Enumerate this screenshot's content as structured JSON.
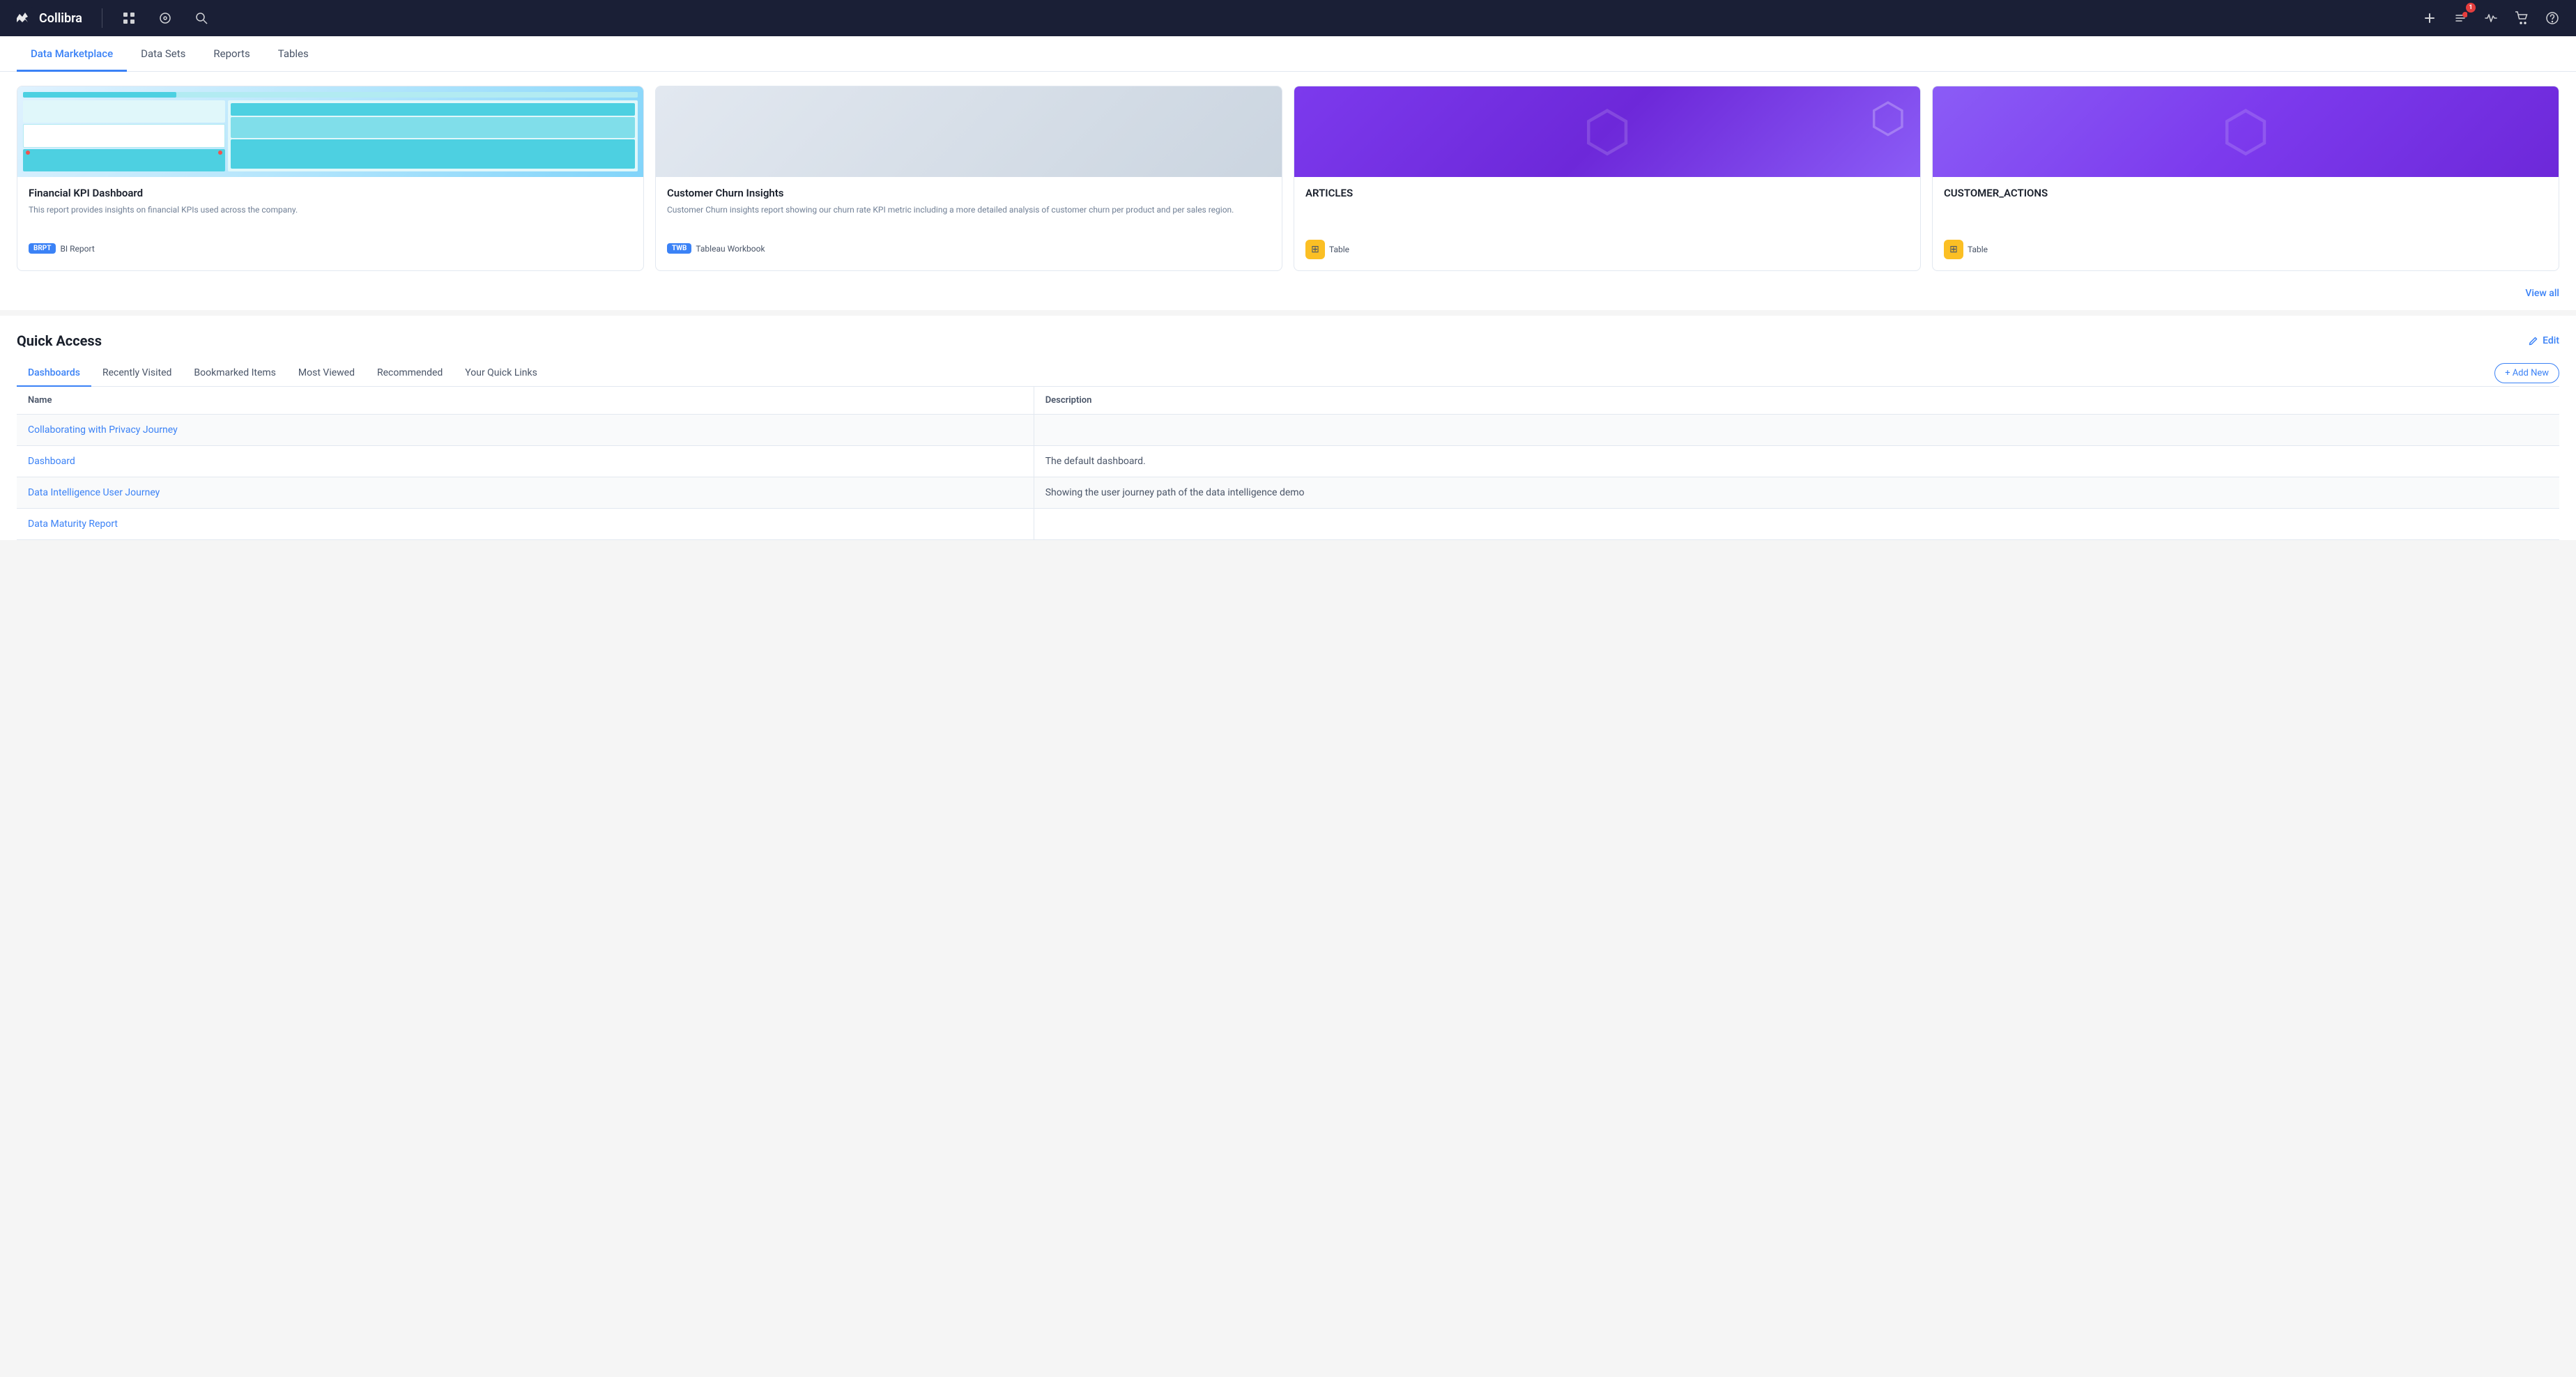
{
  "topnav": {
    "logo_text": "Collibra",
    "icons": [
      "grid",
      "compass",
      "search"
    ],
    "right_icons": [
      "plus",
      "tasks",
      "activity",
      "cart",
      "help"
    ],
    "badge_count": "1"
  },
  "tabs": {
    "items": [
      {
        "label": "Data Marketplace",
        "active": true
      },
      {
        "label": "Data Sets",
        "active": false
      },
      {
        "label": "Reports",
        "active": false
      },
      {
        "label": "Tables",
        "active": false
      }
    ]
  },
  "cards": [
    {
      "title": "Financial KPI Dashboard",
      "description": "This report provides insights on financial KPIs used across the company.",
      "badge_code": "BRPT",
      "badge_label": "BI Report",
      "type": "dashboard"
    },
    {
      "title": "Customer Churn Insights",
      "description": "Customer Churn insights report showing our churn rate KPI metric including a more detailed analysis of customer churn per product and per sales region.",
      "badge_code": "TWB",
      "badge_label": "Tableau Workbook",
      "type": "gray"
    },
    {
      "title": "ARTICLES",
      "description": "",
      "badge_code": "TABLE",
      "badge_label": "Table",
      "type": "purple1"
    },
    {
      "title": "CUSTOMER_ACTIONS",
      "description": "",
      "badge_code": "TABLE",
      "badge_label": "Table",
      "type": "purple2"
    }
  ],
  "view_all_label": "View all",
  "quick_access": {
    "title": "Quick Access",
    "edit_label": "Edit",
    "tabs": [
      {
        "label": "Dashboards",
        "active": true
      },
      {
        "label": "Recently Visited",
        "active": false
      },
      {
        "label": "Bookmarked Items",
        "active": false
      },
      {
        "label": "Most Viewed",
        "active": false
      },
      {
        "label": "Recommended",
        "active": false
      },
      {
        "label": "Your Quick Links",
        "active": false
      }
    ],
    "add_new_label": "+ Add New",
    "table": {
      "columns": [
        "Name",
        "Description"
      ],
      "rows": [
        {
          "name": "Collaborating with Privacy Journey",
          "description": ""
        },
        {
          "name": "Dashboard",
          "description": "The default dashboard."
        },
        {
          "name": "Data Intelligence User Journey",
          "description": "Showing the user journey path of the data intelligence demo"
        },
        {
          "name": "Data Maturity Report",
          "description": ""
        }
      ]
    }
  }
}
